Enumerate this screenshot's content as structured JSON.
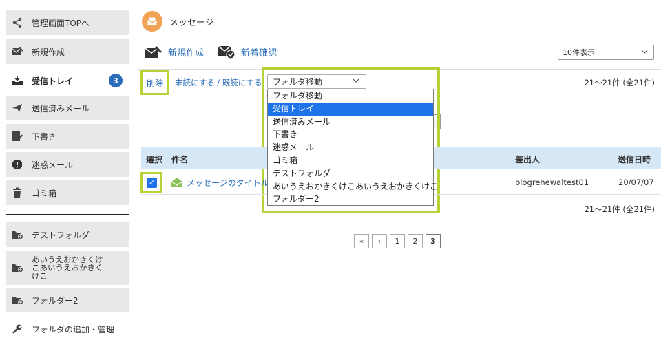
{
  "sidebar": {
    "items": [
      {
        "label": "管理画面TOPへ",
        "icon": "share-icon"
      },
      {
        "label": "新規作成",
        "icon": "compose-icon"
      },
      {
        "label": "受信トレイ",
        "icon": "inbox-icon",
        "badge": "3"
      },
      {
        "label": "送信済みメール",
        "icon": "send-icon"
      },
      {
        "label": "下書き",
        "icon": "draft-icon"
      },
      {
        "label": "迷惑メール",
        "icon": "spam-icon"
      },
      {
        "label": "ゴミ箱",
        "icon": "trash-icon"
      }
    ],
    "folders": [
      {
        "label": "テストフォルダ",
        "icon": "folder-add-icon"
      },
      {
        "label": "あいうえおかきくけこあいうえおかきくけこ",
        "icon": "folder-add-icon"
      },
      {
        "label": "フォルダー2",
        "icon": "folder-add-icon"
      }
    ],
    "manage_label": "フォルダの追加・管理"
  },
  "header": {
    "title": "メッセージ"
  },
  "toolbar": {
    "compose_label": "新規作成",
    "check_new_label": "新着確認",
    "per_page_value": "10件表示"
  },
  "actions": {
    "delete_label": "削除",
    "mark_read_label": "未読にする / 既読にする",
    "folder_move_value": "フォルダ移動",
    "count_text": "21～21件 (全21件)"
  },
  "folder_options": [
    "フォルダ移動",
    "受信トレイ",
    "送信済みメール",
    "下書き",
    "迷惑メール",
    "ゴミ箱",
    "テストフォルダ",
    "あいうえおかきくけこあいうえおかきくけこ",
    "フォルダー2"
  ],
  "folder_selected_index": 1,
  "table": {
    "headers": {
      "select": "選択",
      "subject": "件名",
      "sender": "差出人",
      "date": "送信日時"
    },
    "rows": [
      {
        "subject": "メッセージのタイトル",
        "sender": "blogrenewaltest01",
        "date": "20/07/07",
        "checked": true
      }
    ]
  },
  "pager": {
    "first": "«",
    "prev": "‹",
    "pages": [
      "1",
      "2",
      "3"
    ],
    "current": "3"
  },
  "colors": {
    "accent": "#2a6ebb",
    "highlight": "#b5d334",
    "header_bg": "#d6e7f5",
    "message_icon": "#f0a255"
  }
}
